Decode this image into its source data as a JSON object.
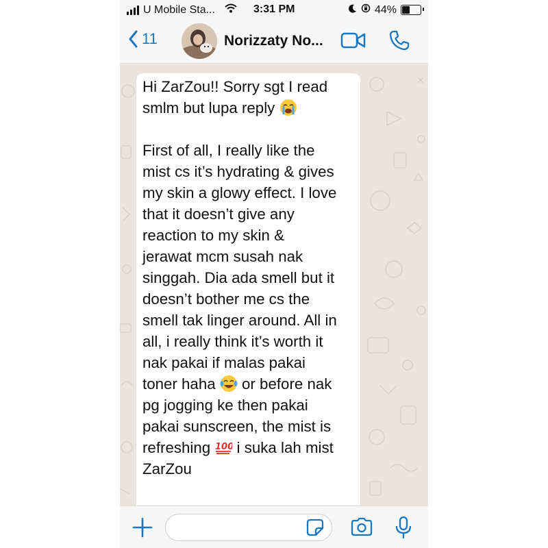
{
  "status_bar": {
    "carrier": "U Mobile Sta...",
    "time": "3:31 PM",
    "battery_percent": "44%",
    "battery_level": 0.44,
    "icons": [
      "signal-icon",
      "wifi-icon",
      "moon-icon",
      "orientation-lock-icon",
      "battery-icon"
    ]
  },
  "header": {
    "back_label": "11",
    "contact_name": "Norizzaty No...",
    "icons": [
      "back-chevron-icon",
      "avatar",
      "video-call-icon",
      "phone-call-icon"
    ]
  },
  "message": {
    "text": "Hi ZarZou!! Sorry sgt I read smlm but lupa reply 😭\n\nFirst of all, I really like the mist cs it’s hydrating & gives my skin a glowy effect. I love that it doesn’t give any reaction to my skin & jerawat mcm susah nak singgah. Dia ada smell but it doesn’t bother me cs the smell tak linger around. All in all, i really think it’s worth it nak pakai if malas pakai toner haha 😂 or before nak pg jogging ke then pakai pakai sunscreen, the mist is refreshing 💯 i suka lah mist ZarZou",
    "lines": [
      {
        "parts": [
          "Hi ZarZou!! Sorry sgt I read"
        ]
      },
      {
        "parts": [
          "smlm but lupa reply "
        ],
        "emoji": "loudly-crying-face",
        "emoji_char": "😭"
      },
      {
        "parts": [
          ""
        ]
      },
      {
        "parts": [
          "First of all, I really like the"
        ]
      },
      {
        "parts": [
          "mist cs it’s hydrating & gives"
        ]
      },
      {
        "parts": [
          "my skin a glowy effect. I love"
        ]
      },
      {
        "parts": [
          "that it doesn’t give any"
        ]
      },
      {
        "parts": [
          "reaction to my skin &"
        ]
      },
      {
        "parts": [
          "jerawat mcm susah nak"
        ]
      },
      {
        "parts": [
          "singgah. Dia ada smell but it"
        ]
      },
      {
        "parts": [
          "doesn’t bother me cs the"
        ]
      },
      {
        "parts": [
          "smell tak linger around. All in"
        ]
      },
      {
        "parts": [
          "all, i really think it’s worth it"
        ]
      },
      {
        "parts": [
          "nak pakai if malas pakai"
        ]
      },
      {
        "parts": [
          "toner haha ",
          " or before nak"
        ],
        "emoji": "face-with-tears-of-joy",
        "emoji_char": "😂"
      },
      {
        "parts": [
          "pg jogging ke then pakai"
        ]
      },
      {
        "parts": [
          "pakai sunscreen, the mist is"
        ]
      },
      {
        "parts": [
          "refreshing ",
          " i suka lah mist"
        ],
        "emoji": "hundred-points",
        "emoji_char": "💯"
      },
      {
        "parts": [
          "ZarZou"
        ]
      }
    ]
  },
  "input_bar": {
    "placeholder": "",
    "icons": [
      "plus-icon",
      "sticker-icon",
      "camera-icon",
      "microphone-icon"
    ]
  },
  "colors": {
    "accent": "#1a78c2",
    "chat_background": "#ece5dd",
    "bubble": "#ffffff",
    "bar": "#f7f7f7"
  }
}
